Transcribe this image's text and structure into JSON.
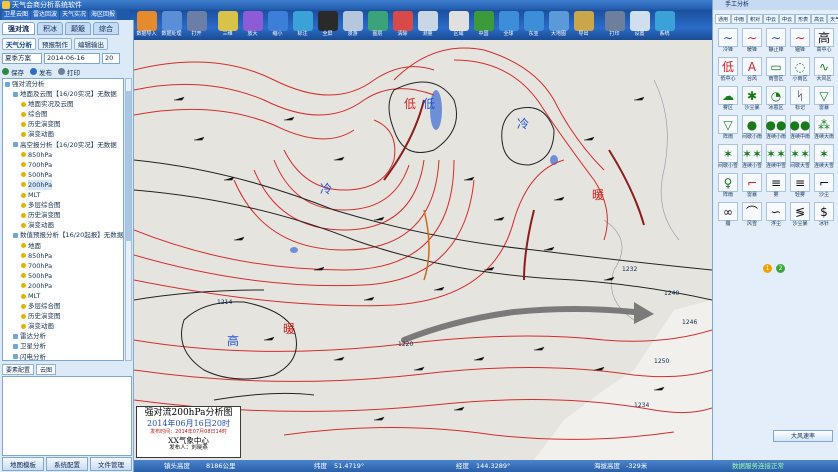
{
  "app": {
    "title": "天气会商分析系统软件"
  },
  "top_nav": [
    "卫星云图",
    "雷达回波",
    "天气实况",
    "海区回报"
  ],
  "ribbon": {
    "buttons": [
      {
        "label": "数据导入",
        "icon": "data-import-icon",
        "color": "#e58b2f"
      },
      {
        "label": "数据处理",
        "icon": "data-process-icon",
        "color": "#5a8fd8"
      },
      {
        "label": "打开",
        "icon": "open-icon",
        "color": "#6b7fa6"
      },
      {
        "label": "三维",
        "icon": "3d-icon",
        "color": "#d8c24a"
      },
      {
        "label": "放大",
        "icon": "zoom-in-icon",
        "color": "#8e5bd6"
      },
      {
        "label": "缩小",
        "icon": "zoom-out-icon",
        "color": "#3c7fd8"
      },
      {
        "label": "标注",
        "icon": "label-icon",
        "color": "#3aa2d8"
      },
      {
        "label": "全屏",
        "icon": "fullscreen-icon",
        "color": "#2a2a2a"
      },
      {
        "label": "漫游",
        "icon": "pan-hand-icon",
        "color": "#b5c7dc"
      },
      {
        "label": "图层",
        "icon": "layers-icon",
        "color": "#3aa37a"
      },
      {
        "label": "清除",
        "icon": "clear-icon",
        "color": "#d84a4a"
      },
      {
        "label": "测量",
        "icon": "measure-icon",
        "color": "#c9d6e6"
      },
      {
        "label": "区域",
        "icon": "region-icon",
        "color": "#e0e0e0"
      },
      {
        "label": "中国",
        "icon": "china-map-icon",
        "color": "#3b9b3b"
      },
      {
        "label": "全球",
        "icon": "globe-icon",
        "color": "#3c8ed8"
      },
      {
        "label": "东亚",
        "icon": "east-asia-icon",
        "color": "#3c8ed8"
      },
      {
        "label": "大地图",
        "icon": "big-map-icon",
        "color": "#5a9ad8"
      },
      {
        "label": "导出",
        "icon": "export-icon",
        "color": "#c9a64a"
      },
      {
        "label": "打印",
        "icon": "print-icon",
        "color": "#6c7f9c"
      },
      {
        "label": "设置",
        "icon": "settings-icon",
        "color": "#d0dff0"
      },
      {
        "label": "系统",
        "icon": "system-icon",
        "color": "#3aa2d8"
      }
    ]
  },
  "left": {
    "main_tabs": [
      "强对流",
      "积冰",
      "颠簸",
      "综合"
    ],
    "sub_tabs": [
      "天气分析",
      "预报制作",
      "编辑输出"
    ],
    "mode_select": "夏季方案",
    "date_value": "2014-06-16",
    "hour_value": "20",
    "actions": [
      "保存",
      "发布",
      "打印"
    ],
    "tree": [
      {
        "label": "强对流分析",
        "level": 0,
        "type": "folder"
      },
      {
        "label": "地面及云图【16/20实况】无数据",
        "level": 1,
        "type": "folder"
      },
      {
        "label": "地面实况及云图",
        "level": 2,
        "type": "leaf"
      },
      {
        "label": "综合图",
        "level": 2,
        "type": "leaf"
      },
      {
        "label": "历史演变图",
        "level": 2,
        "type": "leaf"
      },
      {
        "label": "演变动画",
        "level": 2,
        "type": "leaf"
      },
      {
        "label": "高空报分析【16/20实况】无数据",
        "level": 1,
        "type": "folder"
      },
      {
        "label": "850hPa",
        "level": 2,
        "type": "leaf"
      },
      {
        "label": "700hPa",
        "level": 2,
        "type": "leaf"
      },
      {
        "label": "500hPa",
        "level": 2,
        "type": "leaf"
      },
      {
        "label": "200hPa",
        "level": 2,
        "type": "leaf",
        "selected": true
      },
      {
        "label": "MLT",
        "level": 2,
        "type": "leaf"
      },
      {
        "label": "多层综合图",
        "level": 2,
        "type": "leaf"
      },
      {
        "label": "历史演变图",
        "level": 2,
        "type": "leaf"
      },
      {
        "label": "演变动画",
        "level": 2,
        "type": "leaf"
      },
      {
        "label": "数值预报分析【16/20起报】无数据",
        "level": 1,
        "type": "folder"
      },
      {
        "label": "地面",
        "level": 2,
        "type": "leaf"
      },
      {
        "label": "850hPa",
        "level": 2,
        "type": "leaf"
      },
      {
        "label": "700hPa",
        "level": 2,
        "type": "leaf"
      },
      {
        "label": "500hPa",
        "level": 2,
        "type": "leaf"
      },
      {
        "label": "200hPa",
        "level": 2,
        "type": "leaf"
      },
      {
        "label": "MLT",
        "level": 2,
        "type": "leaf"
      },
      {
        "label": "多层综合图",
        "level": 2,
        "type": "leaf"
      },
      {
        "label": "历史演变图",
        "level": 2,
        "type": "leaf"
      },
      {
        "label": "演变动画",
        "level": 2,
        "type": "leaf"
      },
      {
        "label": "雷达分析",
        "level": 1,
        "type": "folder"
      },
      {
        "label": "卫星分析",
        "level": 1,
        "type": "folder"
      },
      {
        "label": "闪电分析",
        "level": 1,
        "type": "folder"
      }
    ],
    "lower_tabs": [
      "要素配置",
      "云图"
    ],
    "bottom_buttons": [
      "地图模板",
      "系统配置",
      "文件管理"
    ]
  },
  "map": {
    "labels": [
      {
        "text": "低",
        "kind": "cold"
      },
      {
        "text": "低",
        "kind": "warm"
      },
      {
        "text": "冷",
        "kind": "cold"
      },
      {
        "text": "冷",
        "kind": "cold"
      },
      {
        "text": "暖",
        "kind": "warm"
      },
      {
        "text": "高",
        "kind": "cold"
      },
      {
        "text": "暖",
        "kind": "warm"
      },
      {
        "text": "暖",
        "kind": "warm"
      }
    ],
    "contour_values": [
      "1214",
      "1220",
      "1232",
      "1240",
      "1246",
      "1250",
      "1234"
    ],
    "title_box": {
      "title": "强对流200hPa分析图",
      "datetime": "2014年06月16日20时",
      "publish_time": "发布时间：2014年07月08日14时",
      "center": "XX气象中心",
      "publisher": "发布人：刘晓燕"
    }
  },
  "right": {
    "title": "手工分析",
    "tabs": [
      "通用",
      "中雨",
      "积对",
      "中云",
      "中云",
      "形表",
      "高云",
      "天气"
    ],
    "symbols": [
      {
        "glyph": "∼",
        "name": "冷锋",
        "color": "blue"
      },
      {
        "glyph": "∼",
        "name": "暖锋",
        "color": "red"
      },
      {
        "glyph": "∼",
        "name": "静止锋",
        "color": "blue"
      },
      {
        "glyph": "∼",
        "name": "锢锋",
        "color": "red"
      },
      {
        "glyph": "高",
        "name": "高中心",
        "color": "blk"
      },
      {
        "glyph": "低",
        "name": "低中心",
        "color": "red"
      },
      {
        "glyph": "A",
        "name": "台风",
        "color": "red"
      },
      {
        "glyph": "▭",
        "name": "雨雪区",
        "color": ""
      },
      {
        "glyph": "◌",
        "name": "小雨区",
        "color": ""
      },
      {
        "glyph": "∿",
        "name": "大风区",
        "color": ""
      },
      {
        "glyph": "☁",
        "name": "雾区",
        "color": ""
      },
      {
        "glyph": "✱",
        "name": "沙尘暴",
        "color": ""
      },
      {
        "glyph": "◔",
        "name": "冰雹区",
        "color": ""
      },
      {
        "glyph": "ᛋ",
        "name": "标记",
        "color": "blk"
      },
      {
        "glyph": "▽",
        "name": "雷暴",
        "color": ""
      },
      {
        "glyph": "▽",
        "name": "阵雨",
        "color": ""
      },
      {
        "glyph": "●",
        "name": "间歇小雨",
        "color": ""
      },
      {
        "glyph": "●●",
        "name": "连续小雨",
        "color": ""
      },
      {
        "glyph": "●●",
        "name": "连续中雨",
        "color": ""
      },
      {
        "glyph": "⁂",
        "name": "连续大雨",
        "color": ""
      },
      {
        "glyph": "✶",
        "name": "间歇小雪",
        "color": ""
      },
      {
        "glyph": "✶✶",
        "name": "连续小雪",
        "color": ""
      },
      {
        "glyph": "✶✶",
        "name": "连续中雪",
        "color": ""
      },
      {
        "glyph": "✶✶",
        "name": "间歇大雪",
        "color": ""
      },
      {
        "glyph": "✶",
        "name": "连续大雪",
        "color": ""
      },
      {
        "glyph": "♀",
        "name": "阵雨",
        "color": ""
      },
      {
        "glyph": "⌐",
        "name": "雷暴",
        "color": "red"
      },
      {
        "glyph": "≡",
        "name": "雾",
        "color": "blk"
      },
      {
        "glyph": "≡",
        "name": "轻雾",
        "color": "blk"
      },
      {
        "glyph": "⌐",
        "name": "沙尘",
        "color": "blk"
      },
      {
        "glyph": "∞",
        "name": "霾",
        "color": "blk"
      },
      {
        "glyph": "⌒",
        "name": "风雪",
        "color": "blk"
      },
      {
        "glyph": "∽",
        "name": "浮尘",
        "color": "blk"
      },
      {
        "glyph": "≶",
        "name": "沙尘暴",
        "color": "blk"
      },
      {
        "glyph": "$",
        "name": "冰针",
        "color": "blk"
      }
    ],
    "pages": [
      "1",
      "2"
    ],
    "bottom_button": "大风速率"
  },
  "statusbar": {
    "altitude_label": "镇头高度",
    "altitude_value": "8186公里",
    "lat_label": "纬度",
    "lat_value": "51.4719°",
    "lon_label": "经度",
    "lon_value": "144.3289°",
    "sea_label": "海拔高度",
    "sea_value": "-329米",
    "service": "数据服务连接正常"
  },
  "colors": {
    "ribbon": "#1f5aa8",
    "contour_red": "#d42c2c",
    "contour_black": "#222222",
    "jet_arrow": "#7a7a7a"
  }
}
